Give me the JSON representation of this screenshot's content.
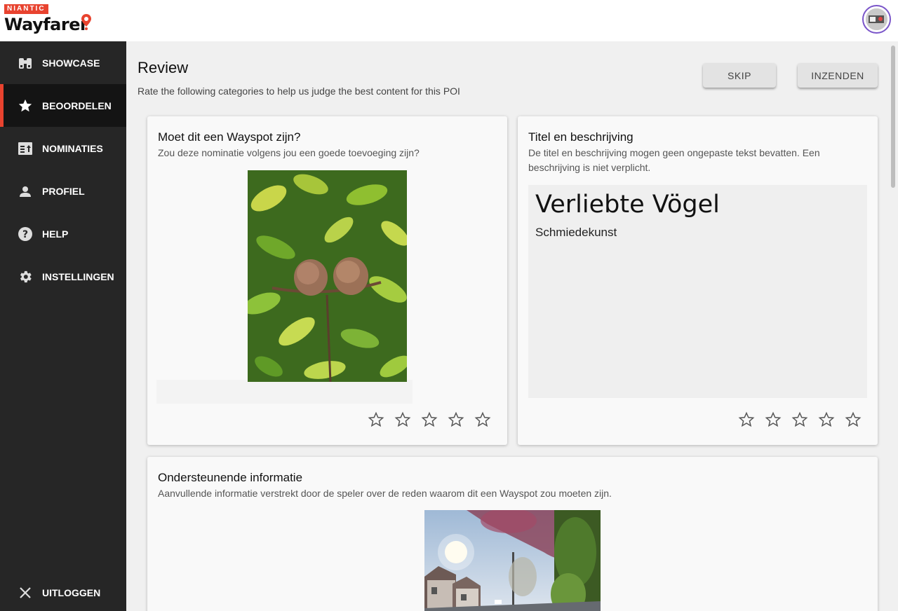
{
  "header": {
    "brand_top": "NIANTIC",
    "brand_name": "Wayfarer",
    "accent": "#e8432f",
    "avatar_icon": "user-avatar"
  },
  "sidebar": {
    "items": [
      {
        "label": "SHOWCASE",
        "icon": "binoculars-icon"
      },
      {
        "label": "BEOORDELEN",
        "icon": "star-icon",
        "active": true
      },
      {
        "label": "NOMINATIES",
        "icon": "nominations-icon"
      },
      {
        "label": "PROFIEL",
        "icon": "person-icon"
      },
      {
        "label": "HELP",
        "icon": "help-icon"
      },
      {
        "label": "INSTELLINGEN",
        "icon": "gear-icon"
      }
    ],
    "logout": {
      "label": "UITLOGGEN",
      "icon": "close-icon"
    }
  },
  "main": {
    "title": "Review",
    "subtitle": "Rate the following categories to help us judge the best content for this POI",
    "skip_label": "SKIP",
    "submit_label": "INZENDEN"
  },
  "cards": {
    "wayspot": {
      "title": "Moet dit een Wayspot zijn?",
      "subtitle": "Zou deze nominatie volgens jou een goede toevoeging zijn?",
      "rating": 0
    },
    "title_desc": {
      "title": "Titel en beschrijving",
      "subtitle": "De titel en beschrijving mogen geen ongepaste tekst bevatten. Een beschrijving is niet verplicht.",
      "poi_title": "Verliebte Vögel",
      "poi_description": "Schmiedekunst",
      "rating": 0
    },
    "supporting": {
      "title": "Ondersteunende informatie",
      "subtitle": "Aanvullende informatie verstrekt door de speler over de reden waarom dit een Wayspot zou moeten zijn."
    }
  }
}
